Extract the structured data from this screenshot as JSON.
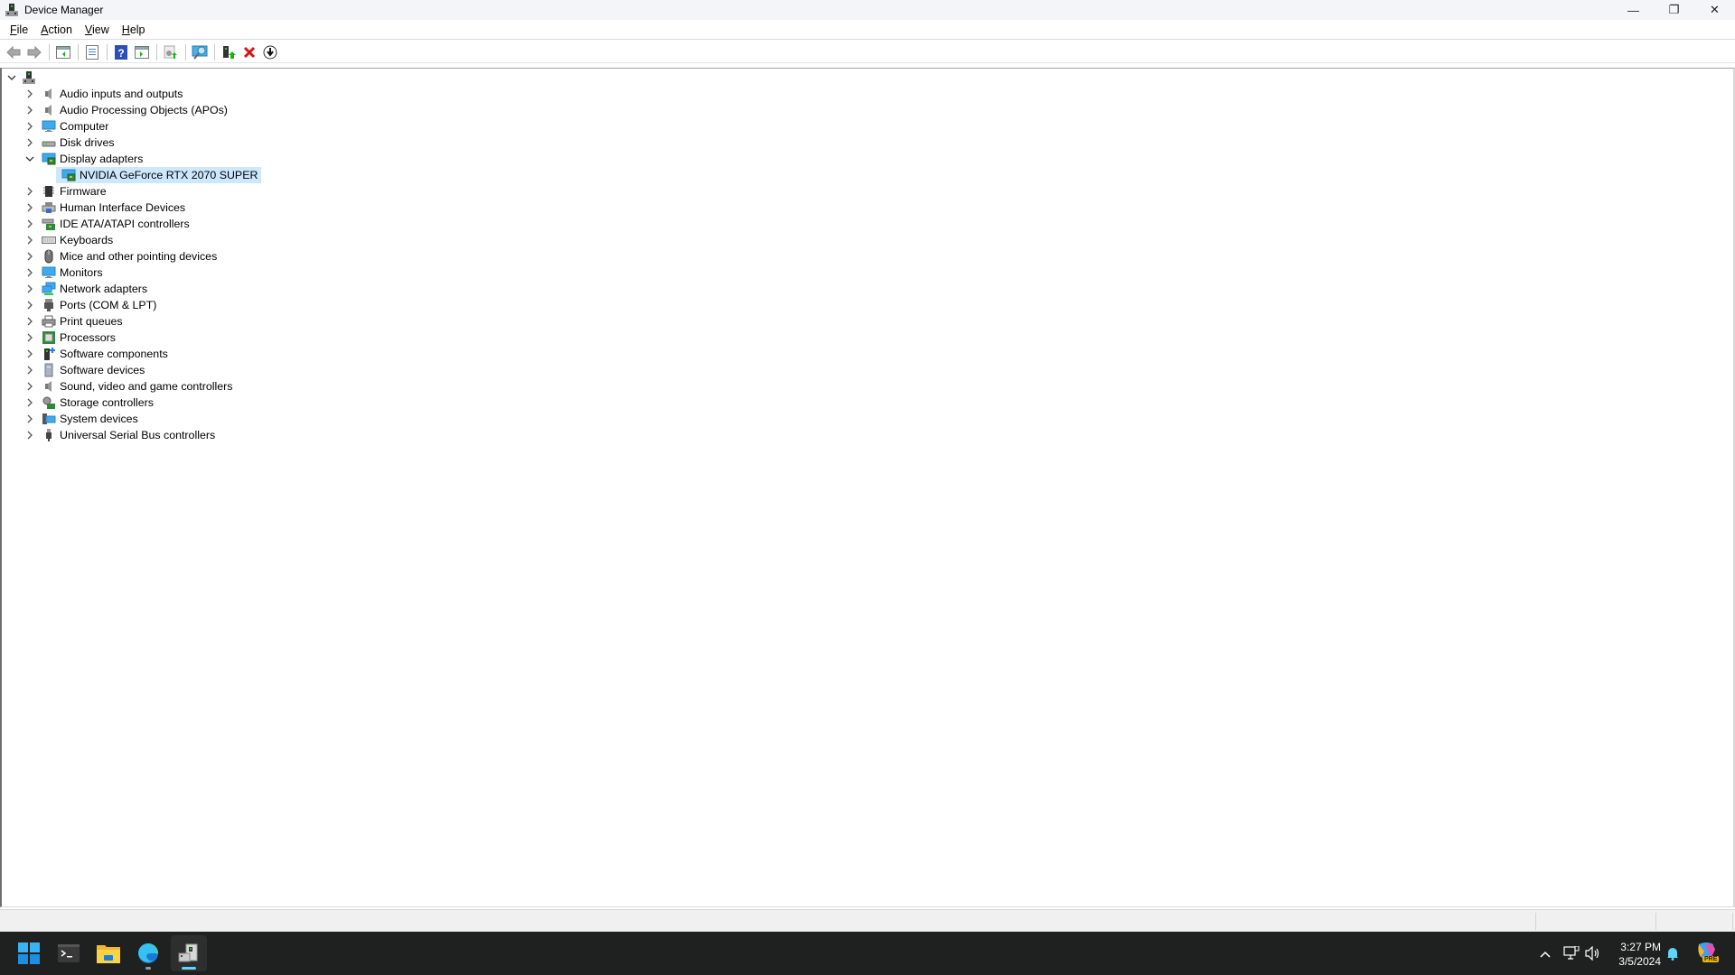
{
  "window": {
    "title": "Device Manager",
    "controls": {
      "minimize": "—",
      "restore": "❐",
      "close": "✕"
    }
  },
  "menu": [
    {
      "label": "File",
      "accel": "F",
      "rest": "ile"
    },
    {
      "label": "Action",
      "accel": "A",
      "rest": "ction"
    },
    {
      "label": "View",
      "accel": "V",
      "rest": "iew"
    },
    {
      "label": "Help",
      "accel": "H",
      "rest": "elp"
    }
  ],
  "toolbar": {
    "buttons": [
      {
        "name": "back",
        "icon": "back-arrow-icon",
        "enabled": false
      },
      {
        "name": "forward",
        "icon": "forward-arrow-icon",
        "enabled": false
      },
      {
        "name": "show-hide-console-tree",
        "icon": "console-tree-icon"
      },
      {
        "name": "properties",
        "icon": "properties-icon"
      },
      {
        "name": "help",
        "icon": "help-icon"
      },
      {
        "name": "show-action-pane",
        "icon": "action-pane-icon"
      },
      {
        "name": "update-driver",
        "icon": "update-driver-icon"
      },
      {
        "name": "scan-hardware-changes",
        "icon": "scan-hardware-icon"
      },
      {
        "name": "add-legacy-hardware",
        "icon": "add-hardware-icon"
      },
      {
        "name": "uninstall-device",
        "icon": "uninstall-x-icon"
      },
      {
        "name": "disable-device",
        "icon": "disable-device-icon"
      }
    ]
  },
  "tree": {
    "root": {
      "label": "",
      "expanded": true,
      "icon": "computer-root-icon"
    },
    "categories": [
      {
        "label": "Audio inputs and outputs",
        "icon": "speaker-icon",
        "expanded": false
      },
      {
        "label": "Audio Processing Objects (APOs)",
        "icon": "speaker-icon",
        "expanded": false
      },
      {
        "label": "Computer",
        "icon": "monitor-icon",
        "expanded": false
      },
      {
        "label": "Disk drives",
        "icon": "disk-drive-icon",
        "expanded": false
      },
      {
        "label": "Display adapters",
        "icon": "display-adapter-icon",
        "expanded": true,
        "children": [
          {
            "label": "NVIDIA GeForce RTX 2070 SUPER",
            "icon": "display-adapter-icon",
            "selected": true
          }
        ]
      },
      {
        "label": "Firmware",
        "icon": "firmware-chip-icon",
        "expanded": false
      },
      {
        "label": "Human Interface Devices",
        "icon": "hid-icon",
        "expanded": false
      },
      {
        "label": "IDE ATA/ATAPI controllers",
        "icon": "ide-controller-icon",
        "expanded": false
      },
      {
        "label": "Keyboards",
        "icon": "keyboard-icon",
        "expanded": false
      },
      {
        "label": "Mice and other pointing devices",
        "icon": "mouse-icon",
        "expanded": false
      },
      {
        "label": "Monitors",
        "icon": "monitor-icon",
        "expanded": false
      },
      {
        "label": "Network adapters",
        "icon": "network-icon",
        "expanded": false
      },
      {
        "label": "Ports (COM & LPT)",
        "icon": "port-icon",
        "expanded": false
      },
      {
        "label": "Print queues",
        "icon": "printer-icon",
        "expanded": false
      },
      {
        "label": "Processors",
        "icon": "processor-icon",
        "expanded": false
      },
      {
        "label": "Software components",
        "icon": "software-component-icon",
        "expanded": false
      },
      {
        "label": "Software devices",
        "icon": "software-device-icon",
        "expanded": false
      },
      {
        "label": "Sound, video and game controllers",
        "icon": "speaker-icon",
        "expanded": false
      },
      {
        "label": "Storage controllers",
        "icon": "storage-controller-icon",
        "expanded": false
      },
      {
        "label": "System devices",
        "icon": "system-devices-icon",
        "expanded": false
      },
      {
        "label": "Universal Serial Bus controllers",
        "icon": "usb-icon",
        "expanded": false
      }
    ]
  },
  "taskbar": {
    "apps": [
      {
        "name": "start",
        "icon": "windows-start-icon"
      },
      {
        "name": "terminal",
        "icon": "terminal-icon"
      },
      {
        "name": "file-explorer",
        "icon": "folder-icon"
      },
      {
        "name": "edge",
        "icon": "edge-browser-icon",
        "running": true
      },
      {
        "name": "device-manager",
        "icon": "device-manager-icon",
        "active": true
      }
    ],
    "tray": {
      "overflow": "^",
      "time": "3:27 PM",
      "date": "3/5/2024",
      "copilot_badge": "PRE"
    }
  },
  "colors": {
    "selection": "#cce8ff",
    "taskbar_bg": "#1f2120",
    "accent": "#5fd4ff"
  }
}
